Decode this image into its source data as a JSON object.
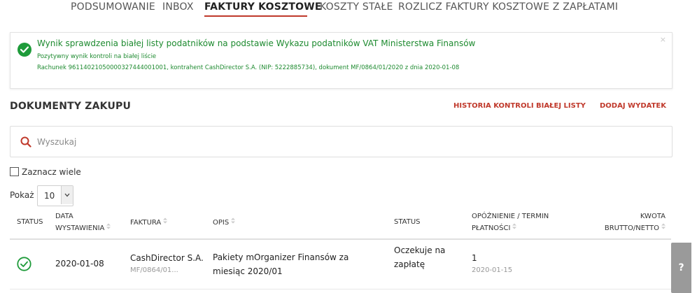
{
  "nav": {
    "tabs": [
      {
        "label": "PODSUMOWANIE"
      },
      {
        "label": "INBOX"
      },
      {
        "label": "FAKTURY KOSZTOWE"
      },
      {
        "label": "KOSZTY STAŁE"
      },
      {
        "label": "ROZLICZ FAKTURY KOSZTOWE Z ZAPŁATAMI"
      }
    ],
    "active_tab": "FAKTURY KOSZTOWE"
  },
  "alert": {
    "title": "Wynik sprawdzenia białej listy podatników na podstawie Wykazu podatników VAT Ministerstwa Finansów",
    "subtitle": "Pozytywny wynik kontroli na białej liście",
    "detail": "Rachunek 96114021050000327444001001, kontrahent CashDirector S.A. (NIP: 5222885734), dokument MF/0864/01/2020 z dnia 2020-01-08",
    "close": "×",
    "icon": "check-circle-icon"
  },
  "section": {
    "title": "DOKUMENTY ZAKUPU",
    "history_link": "HISTORIA KONTROLI BIAŁEJ LISTY",
    "add_link": "DODAJ WYDATEK"
  },
  "search": {
    "placeholder": "Wyszukaj",
    "value": "",
    "icon": "search-icon"
  },
  "select_many": {
    "label": "Zaznacz wiele",
    "checked": false
  },
  "page_size": {
    "label": "Pokaż",
    "value": "10"
  },
  "table": {
    "headers": {
      "status": "STATUS",
      "date_line1": "DATA",
      "date_line2": "WYSTAWIENIA",
      "invoice": "FAKTURA",
      "description": "OPIS",
      "status2": "STATUS",
      "delay_line1": "OPÓŹNIENIE / TERMIN",
      "delay_line2": "PŁATNOŚCI",
      "amount_line1": "KWOTA",
      "amount_line2": "BRUTTO/NETTO"
    },
    "rows": [
      {
        "status_icon": "check-circle-icon",
        "date": "2020-01-08",
        "invoice_name": "CashDirector S.A.",
        "invoice_number": "MF/0864/01...",
        "description": "Pakiety mOrganizer Finansów za miesiąc 2020/01",
        "status": "Oczekuje na zapłatę",
        "delay": "1",
        "due_date": "2020-01-15"
      }
    ]
  },
  "help": {
    "label": "?"
  },
  "colors": {
    "accent": "#c0392b",
    "success": "#1e9b3a",
    "help_tab": "#9a9a9a"
  }
}
